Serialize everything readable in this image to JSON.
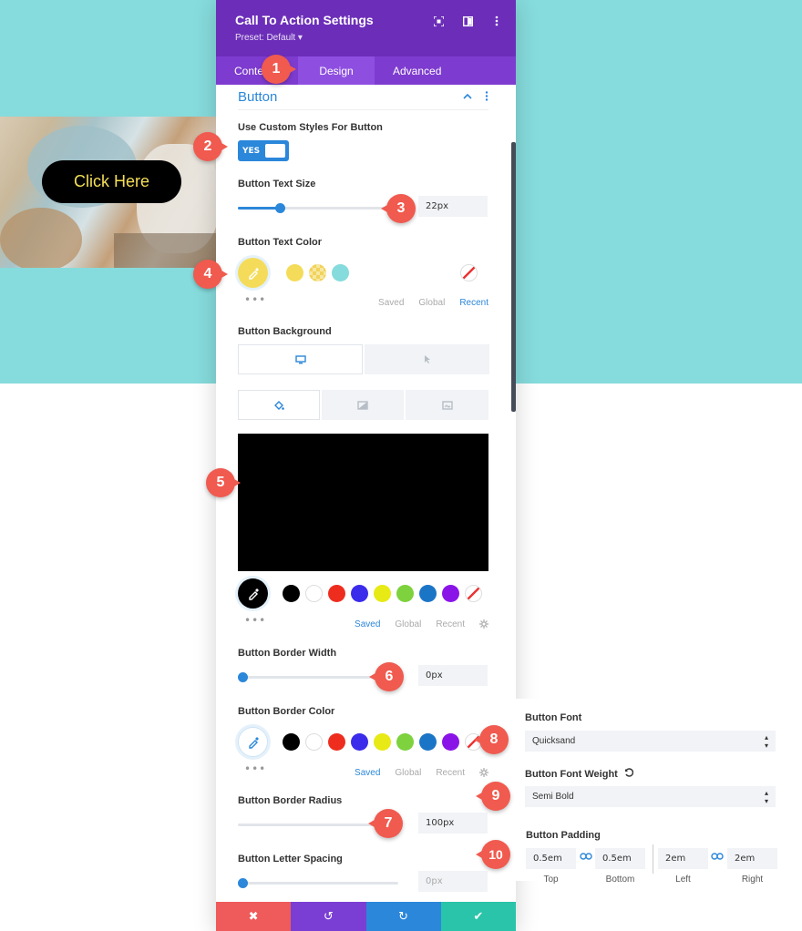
{
  "cta": {
    "button_label": "Click Here"
  },
  "panel": {
    "title": "Call To Action Settings",
    "preset": "Preset: Default ▾",
    "tabs": [
      {
        "label": "Content"
      },
      {
        "label": "Design"
      },
      {
        "label": "Advanced"
      }
    ],
    "section_title": "Button",
    "custom_styles_label": "Use Custom Styles For Button",
    "toggle_label": "YES",
    "text_size_label": "Button Text Size",
    "text_size_value": "22px",
    "text_size_fraction": 0.26,
    "text_color_label": "Button Text Color",
    "text_color_swatches": [
      "#f4dc5a",
      "#f1d35b",
      "#86dbdc"
    ],
    "color_tabs": {
      "saved": "Saved",
      "global": "Global",
      "recent": "Recent"
    },
    "background_label": "Button Background",
    "background_preview_color": "#000000",
    "bg_swatches": [
      "#000000",
      "#ffffff",
      "#ee2d1f",
      "#3b2bea",
      "#e7ea14",
      "#7dd23d",
      "#1b75c7",
      "#8a14e8"
    ],
    "border_width_label": "Button Border Width",
    "border_width_value": "0px",
    "border_width_fraction": 0.0,
    "border_color_label": "Button Border Color",
    "border_radius_label": "Button Border Radius",
    "border_radius_value": "100px",
    "border_radius_fraction": 0.0,
    "letter_spacing_label": "Button Letter Spacing",
    "letter_spacing_value": "0px",
    "letter_spacing_fraction": 0.0,
    "bottom_buttons": [
      {
        "name": "cancel",
        "glyph": "✖",
        "color": "#ef5a5a"
      },
      {
        "name": "undo",
        "glyph": "↺",
        "color": "#7b3ed4"
      },
      {
        "name": "redo",
        "glyph": "↻",
        "color": "#2b87da"
      },
      {
        "name": "save",
        "glyph": "✔",
        "color": "#29c4a9"
      }
    ]
  },
  "font_panel": {
    "font_label": "Button Font",
    "font_value": "Quicksand",
    "weight_label": "Button Font Weight",
    "weight_value": "Semi Bold",
    "padding_label": "Button Padding",
    "padding": [
      {
        "value": "0.5em",
        "caption": "Top"
      },
      {
        "value": "0.5em",
        "caption": "Bottom"
      },
      {
        "value": "2em",
        "caption": "Left"
      },
      {
        "value": "2em",
        "caption": "Right"
      }
    ]
  },
  "markers": [
    "1",
    "2",
    "3",
    "4",
    "5",
    "6",
    "7",
    "8",
    "9",
    "10"
  ],
  "colors": {
    "accent": "#2b87da",
    "header": "#6c2eb9",
    "tabs": "#7d3bcf",
    "marker": "#f05a4f",
    "teal": "#86dbdc"
  }
}
